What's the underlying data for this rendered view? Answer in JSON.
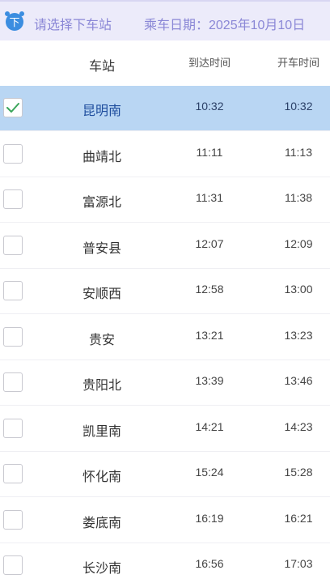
{
  "header": {
    "icon": "download-circle-icon",
    "icon_glyph": "下",
    "title": "请选择下车站",
    "date_label": "乘车日期：2025年10月10日"
  },
  "columns": {
    "station": "车站",
    "arrive": "到达时间",
    "depart": "开车时间"
  },
  "colors": {
    "accent": "#8a87d6",
    "header_bg": "#ecebfa",
    "selected_row": "#b9d6f3",
    "icon_blue": "#3b8de0",
    "check_green": "#3aa55a"
  },
  "stations": [
    {
      "name": "昆明南",
      "arrive": "10:32",
      "depart": "10:32",
      "checked": true
    },
    {
      "name": "曲靖北",
      "arrive": "11:11",
      "depart": "11:13",
      "checked": false
    },
    {
      "name": "富源北",
      "arrive": "11:31",
      "depart": "11:38",
      "checked": false
    },
    {
      "name": "普安县",
      "arrive": "12:07",
      "depart": "12:09",
      "checked": false
    },
    {
      "name": "安顺西",
      "arrive": "12:58",
      "depart": "13:00",
      "checked": false
    },
    {
      "name": "贵安",
      "arrive": "13:21",
      "depart": "13:23",
      "checked": false
    },
    {
      "name": "贵阳北",
      "arrive": "13:39",
      "depart": "13:46",
      "checked": false
    },
    {
      "name": "凯里南",
      "arrive": "14:21",
      "depart": "14:23",
      "checked": false
    },
    {
      "name": "怀化南",
      "arrive": "15:24",
      "depart": "15:28",
      "checked": false
    },
    {
      "name": "娄底南",
      "arrive": "16:19",
      "depart": "16:21",
      "checked": false
    },
    {
      "name": "长沙南",
      "arrive": "16:56",
      "depart": "17:03",
      "checked": false
    }
  ]
}
